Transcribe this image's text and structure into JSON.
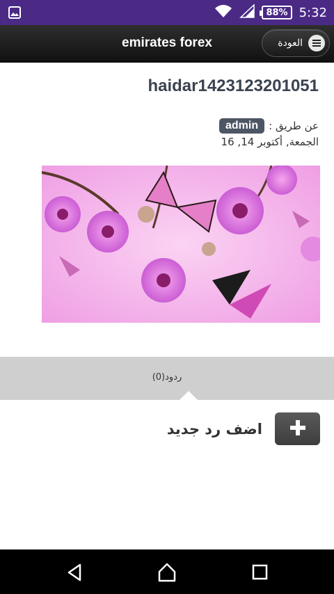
{
  "status_bar": {
    "battery": "88%",
    "time": "5:32"
  },
  "header": {
    "title": "emirates forex",
    "back_label": "العودة"
  },
  "post": {
    "title": "haidar1423123201051",
    "by_label": ": عن طريق",
    "author": "admin",
    "date": "الجمعة, أكتوبر 14, 16"
  },
  "replies": {
    "label": "(0)ردود",
    "add_label": "اضف رد جديد"
  },
  "icons": {
    "status_left": "image-notification-icon",
    "wifi": "wifi-icon",
    "signal": "signal-icon",
    "menu": "menu-icon",
    "plus": "plus-icon",
    "nav_back": "nav-back-icon",
    "nav_home": "nav-home-icon",
    "nav_recent": "nav-recent-icon"
  },
  "colors": {
    "status_bar": "#4b2a86",
    "header": "#1e1e1e",
    "author_badge": "#4d5665",
    "replies_bar": "#cfcfcf",
    "image_background": "#f0a6e8"
  }
}
